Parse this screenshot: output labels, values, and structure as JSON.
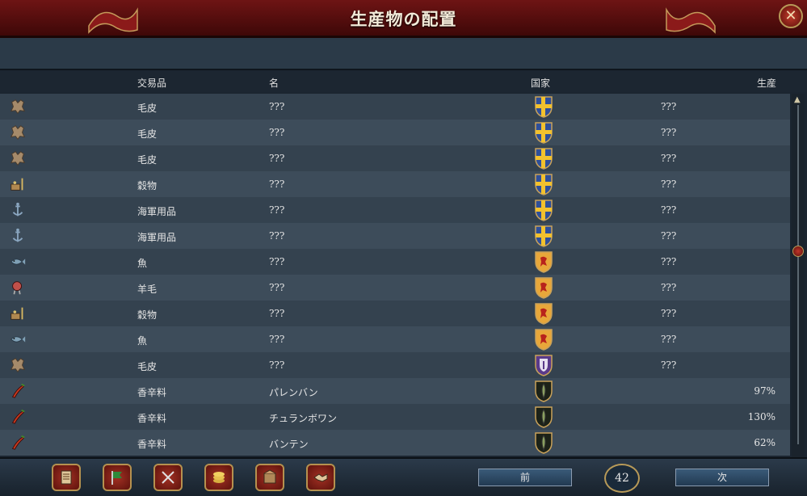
{
  "window": {
    "title": "生産物の配置",
    "close_symbol": "✕"
  },
  "headers": {
    "trade_good": "交易品",
    "name": "名",
    "country": "国家",
    "production": "生産"
  },
  "rows": [
    {
      "icon": "fur-icon",
      "good": "毛皮",
      "name": "???",
      "shield": "swedish-shield",
      "owner": "???",
      "production": ""
    },
    {
      "icon": "fur-icon",
      "good": "毛皮",
      "name": "???",
      "shield": "swedish-shield",
      "owner": "???",
      "production": ""
    },
    {
      "icon": "fur-icon",
      "good": "毛皮",
      "name": "???",
      "shield": "swedish-shield",
      "owner": "???",
      "production": ""
    },
    {
      "icon": "grain-icon",
      "good": "穀物",
      "name": "???",
      "shield": "swedish-shield",
      "owner": "???",
      "production": ""
    },
    {
      "icon": "naval-supplies-icon",
      "good": "海軍用品",
      "name": "???",
      "shield": "swedish-shield",
      "owner": "???",
      "production": ""
    },
    {
      "icon": "naval-supplies-icon",
      "good": "海軍用品",
      "name": "???",
      "shield": "swedish-shield",
      "owner": "???",
      "production": ""
    },
    {
      "icon": "fish-icon",
      "good": "魚",
      "name": "???",
      "shield": "lion-shield",
      "owner": "???",
      "production": ""
    },
    {
      "icon": "wool-icon",
      "good": "羊毛",
      "name": "???",
      "shield": "lion-shield",
      "owner": "???",
      "production": ""
    },
    {
      "icon": "grain-icon",
      "good": "穀物",
      "name": "???",
      "shield": "lion-shield",
      "owner": "???",
      "production": ""
    },
    {
      "icon": "fish-icon",
      "good": "魚",
      "name": "???",
      "shield": "lion-shield",
      "owner": "???",
      "production": ""
    },
    {
      "icon": "fur-icon",
      "good": "毛皮",
      "name": "???",
      "shield": "purple-shield",
      "owner": "???",
      "production": ""
    },
    {
      "icon": "spices-icon",
      "good": "香辛料",
      "name": "パレンバン",
      "shield": "dark-shield",
      "owner": "",
      "production": "97%"
    },
    {
      "icon": "spices-icon",
      "good": "香辛料",
      "name": "チュランボワン",
      "shield": "dark-shield",
      "owner": "",
      "production": "130%"
    },
    {
      "icon": "spices-icon",
      "good": "香辛料",
      "name": "バンテン",
      "shield": "dark-shield",
      "owner": "",
      "production": "62%"
    }
  ],
  "bottom_buttons": [
    {
      "name": "ledger-button",
      "icon": "ledger-icon"
    },
    {
      "name": "flag-button",
      "icon": "flag-icon"
    },
    {
      "name": "military-button",
      "icon": "crossed-swords-icon"
    },
    {
      "name": "economy-button",
      "icon": "coins-icon"
    },
    {
      "name": "trade-button",
      "icon": "crate-icon"
    },
    {
      "name": "diplomacy-button",
      "icon": "handshake-icon"
    }
  ],
  "pagination": {
    "prev_label": "前",
    "next_label": "次",
    "page": "42"
  },
  "colors": {
    "title_bar": "#6e1414",
    "row_odd": "#34424f",
    "row_even": "#3d4c5a",
    "background": "#1b2530"
  }
}
